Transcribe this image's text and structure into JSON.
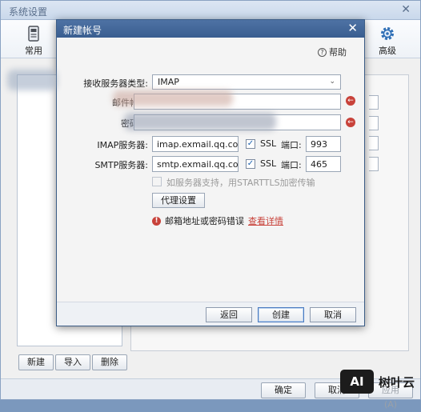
{
  "background_window": {
    "title": "系统设置",
    "close_glyph": "✕",
    "toolbar": [
      {
        "label": "常用",
        "icon": "phone-icon"
      },
      {
        "label": "高级",
        "icon": "gear-icon"
      }
    ],
    "account_buttons": {
      "new": "新建",
      "import": "导入",
      "delete": "删除"
    },
    "footer_buttons": {
      "ok": "确定",
      "cancel": "取消",
      "apply": "应用(A)"
    }
  },
  "dialog": {
    "title": "新建帐号",
    "close_glyph": "✕",
    "help": {
      "icon": "?",
      "label": "帮助"
    },
    "server_type": {
      "label": "接收服务器类型:",
      "value": "IMAP"
    },
    "email": {
      "label": "邮件帐",
      "value": "",
      "alert_icon": "←"
    },
    "password": {
      "label": "密码",
      "value": "",
      "alert_icon": "←"
    },
    "imap": {
      "label": "IMAP服务器:",
      "value": "imap.exmail.qq.com",
      "ssl_label": "SSL",
      "ssl_checked": true,
      "port_label": "端口:",
      "port": "993"
    },
    "smtp": {
      "label": "SMTP服务器:",
      "value": "smtp.exmail.qq.com",
      "ssl_label": "SSL",
      "ssl_checked": true,
      "port_label": "端口:",
      "port": "465"
    },
    "starttls": {
      "label": "如服务器支持，用STARTTLS加密传输",
      "checked": false
    },
    "proxy_button": "代理设置",
    "error": {
      "icon": "!",
      "message": "邮箱地址或密码错误",
      "link": "查看详情"
    },
    "buttons": {
      "back": "返回",
      "create": "创建",
      "cancel": "取消"
    }
  },
  "watermark": {
    "logo": "AI",
    "text": "树叶云"
  },
  "colors": {
    "dialog_title": "#3a5e90",
    "error": "#c8423a",
    "checkbox_check": "#1b5fae"
  }
}
